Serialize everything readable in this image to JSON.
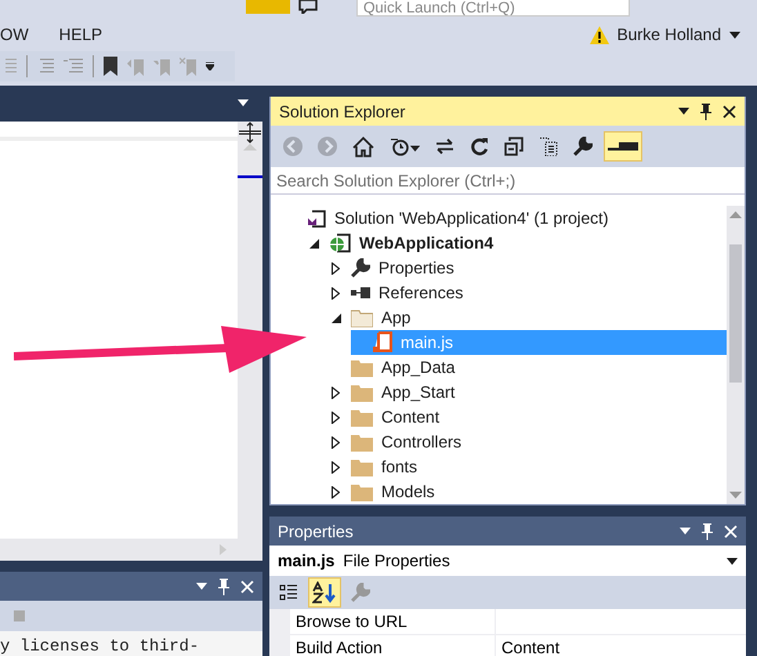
{
  "title_bar": {
    "search_placeholder": "Quick Launch (Ctrl+Q)"
  },
  "menu": [
    "OW",
    "HELP"
  ],
  "account": {
    "name": "Burke Holland",
    "warning": true
  },
  "output_panel": {
    "text": "y licenses to  third-"
  },
  "solution_explorer": {
    "title": "Solution Explorer",
    "active": true,
    "search_placeholder": "Search Solution Explorer (Ctrl+;)",
    "toolbar": [
      {
        "kind": "back",
        "disabled": true,
        "selected": false
      },
      {
        "kind": "forward",
        "disabled": true,
        "selected": false
      },
      {
        "kind": "home",
        "disabled": false,
        "selected": false
      },
      {
        "kind": "pending",
        "disabled": false,
        "selected": false
      },
      {
        "kind": "sync",
        "disabled": false,
        "selected": false
      },
      {
        "kind": "refresh",
        "disabled": false,
        "selected": false
      },
      {
        "kind": "collapse",
        "disabled": false,
        "selected": false
      },
      {
        "kind": "show-all",
        "disabled": false,
        "selected": false
      },
      {
        "kind": "properties",
        "disabled": false,
        "selected": false
      },
      {
        "kind": "preview",
        "disabled": false,
        "selected": true
      }
    ],
    "tree": [
      {
        "label": "Solution 'WebApplication4' (1 project)",
        "kind": "solution",
        "selected": false,
        "children": [
          {
            "label": "WebApplication4",
            "kind": "project",
            "expanded": true,
            "selected": false,
            "children": [
              {
                "label": "Properties",
                "kind": "properties",
                "expanded": false,
                "selected": false
              },
              {
                "label": "References",
                "kind": "references",
                "expanded": false,
                "selected": false
              },
              {
                "label": "App",
                "kind": "folder",
                "expanded": true,
                "selected": false,
                "children": [
                  {
                    "label": "main.js",
                    "kind": "js",
                    "selected": true
                  }
                ]
              },
              {
                "label": "App_Data",
                "kind": "folder",
                "selected": false
              },
              {
                "label": "App_Start",
                "kind": "folder",
                "expanded": false,
                "selected": false
              },
              {
                "label": "Content",
                "kind": "folder",
                "expanded": false,
                "selected": false
              },
              {
                "label": "Controllers",
                "kind": "folder",
                "expanded": false,
                "selected": false
              },
              {
                "label": "fonts",
                "kind": "folder",
                "expanded": false,
                "selected": false
              },
              {
                "label": "Models",
                "kind": "folder",
                "expanded": false,
                "selected": false
              }
            ]
          }
        ]
      }
    ]
  },
  "properties": {
    "title": "Properties",
    "active": false,
    "object_name": "main.js",
    "object_type": "File Properties",
    "toolbar": [
      {
        "kind": "categorized",
        "selected": false,
        "disabled": false
      },
      {
        "kind": "alphabetical",
        "selected": true,
        "disabled": false
      },
      {
        "kind": "property-pages",
        "selected": false,
        "disabled": true
      }
    ],
    "rows": [
      {
        "name": "Browse to URL"
      },
      {
        "name": "Build Action",
        "value": "Content"
      }
    ]
  }
}
